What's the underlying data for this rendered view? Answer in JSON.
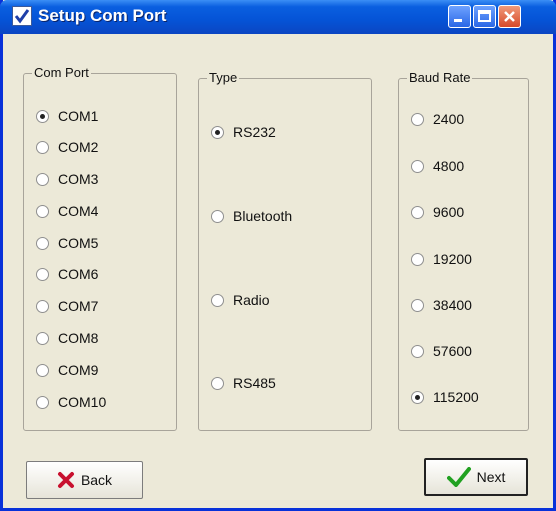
{
  "window": {
    "title": "Setup Com Port"
  },
  "com_port": {
    "label": "Com Port",
    "options": [
      "COM1",
      "COM2",
      "COM3",
      "COM4",
      "COM5",
      "COM6",
      "COM7",
      "COM8",
      "COM9",
      "COM10"
    ],
    "selected": "COM1"
  },
  "type": {
    "label": "Type",
    "options": [
      "RS232",
      "Bluetooth",
      "Radio",
      "RS485"
    ],
    "selected": "RS232"
  },
  "baud_rate": {
    "label": "Baud Rate",
    "options": [
      "2400",
      "4800",
      "9600",
      "19200",
      "38400",
      "57600",
      "115200"
    ],
    "selected": "115200"
  },
  "buttons": {
    "back": "Back",
    "next": "Next"
  },
  "colors": {
    "title_bar": "#0553d6",
    "dialog_bg": "#ece9d8",
    "back_icon": "#c8102e",
    "next_icon": "#21a121"
  }
}
